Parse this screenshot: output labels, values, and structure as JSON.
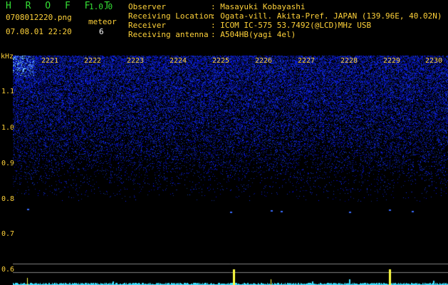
{
  "header": {
    "app_title": "H R O F F T",
    "version": "1.0.0",
    "file_name": "0708012220.png",
    "meteor_label": "meteor",
    "datetime": "07.08.01 22:20",
    "meteor_count": "6"
  },
  "station_info": [
    {
      "label": "Observer",
      "value": ": Masayuki Kobayashi"
    },
    {
      "label": "Receiving Location",
      "value": ": Ogata-vill. Akita-Pref. JAPAN (139.96E, 40.02N)"
    },
    {
      "label": "Receiver",
      "value": ": ICOM IC-575 53.7492(@LCD)MHz USB"
    },
    {
      "label": "Receiving antenna",
      "value": ": A504HB(yagi 4el)"
    }
  ],
  "spectrogram": {
    "frequency_unit": "kHz",
    "y_ticks": [
      "1.1",
      "1.0",
      "0.9",
      "0.8",
      "0.7",
      "0.6"
    ],
    "x_ticks": [
      "2221",
      "2222",
      "2223",
      "2224",
      "2225",
      "2226",
      "2227",
      "2228",
      "2229",
      "2230"
    ],
    "background_color": "#000000",
    "noise_color": "#1a3cff",
    "signal_color": "#ffff40",
    "trace_color": "#40e0ff"
  }
}
